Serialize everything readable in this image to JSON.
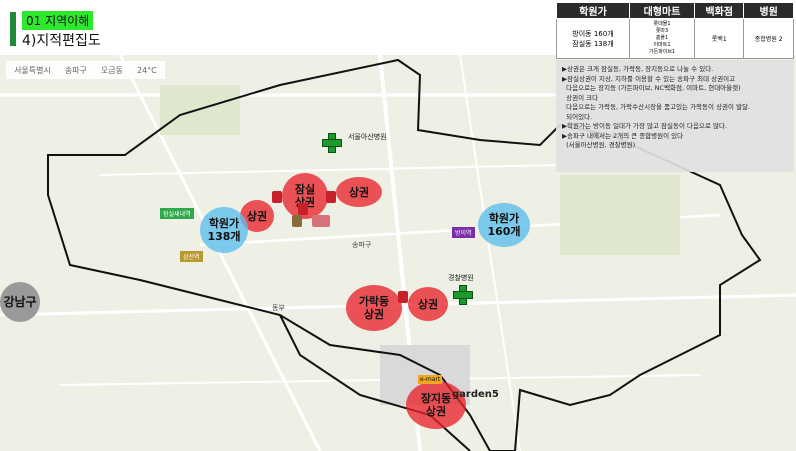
{
  "header": {
    "section_tag": "01 지역이해",
    "title": "4)지적편집도"
  },
  "map": {
    "topbar": [
      "서울특별시",
      "송파구",
      "오금동",
      "24°C"
    ],
    "district_labels": {
      "songpa": "송파구",
      "dongbu": "동부",
      "gangnam": "강남구"
    },
    "blobs": [
      {
        "id": "jamsil",
        "text": "잠실\n상권",
        "color": "red"
      },
      {
        "id": "jamsil-right",
        "text": "상권",
        "color": "red"
      },
      {
        "id": "jamsil-left",
        "text": "상권",
        "color": "red"
      },
      {
        "id": "garak",
        "text": "가락동\n상권",
        "color": "red"
      },
      {
        "id": "garak-right",
        "text": "상권",
        "color": "red"
      },
      {
        "id": "jangji",
        "text": "장지동\n상권",
        "color": "red"
      },
      {
        "id": "hakwon-left",
        "text": "학원가\n138개",
        "color": "blue"
      },
      {
        "id": "hakwon-right",
        "text": "학원가\n160개",
        "color": "blue"
      },
      {
        "id": "gangnam",
        "text": "강남구",
        "color": "gray"
      }
    ],
    "stations": [
      {
        "id": "jamsilnaru",
        "text": "잠실새내역",
        "color": "#2ea84a"
      },
      {
        "id": "samjeon",
        "text": "삼전역",
        "color": "#b89a30"
      },
      {
        "id": "bangi",
        "text": "방이역",
        "color": "#7a2fa8"
      }
    ],
    "hospitals": [
      {
        "id": "asan",
        "label": "서울아산병원"
      },
      {
        "id": "police",
        "label": "경찰병원"
      }
    ],
    "brands": {
      "garden5": "garden5",
      "emart": "e-mart"
    }
  },
  "table": {
    "headers": [
      "학원가",
      "대형마트",
      "백화점",
      "병원"
    ],
    "row": [
      "방이동 160개\n잠실동 138개",
      "롯데몰1\n롯마3\n홈플1\n이마트1\n가든파이브1",
      "롯백1",
      "종합병원 2"
    ]
  },
  "notes": [
    "▶상권은 크게 잠실동, 가락동, 장지동으로 나눌 수 있다.",
    "▶잠실상권이 지상, 지하를 이용할 수 있는 송파구 최대 상권이고\n  다음으로는 장지동 (가든파이브, NC백화점, 이마트, 현대아울렛)\n  상권이 크다\n  다음으로는 가락동, 가락수산시장을 품고있는 가락동이 상권이 발달.\n  되어있다.",
    "▶학원가는 방이동 일대가 가장 많고 잠실동이 다음으로 많다.",
    "▶송파구 내에서는 2개의 큰 종합병원이 있다\n  (서울아산병원, 경찰병원)"
  ],
  "colors": {
    "accent": "#1e8a3a",
    "tag_bg": "#2ee82e",
    "red_blob": "#e8242c",
    "blue_blob": "#5cbeeb"
  }
}
